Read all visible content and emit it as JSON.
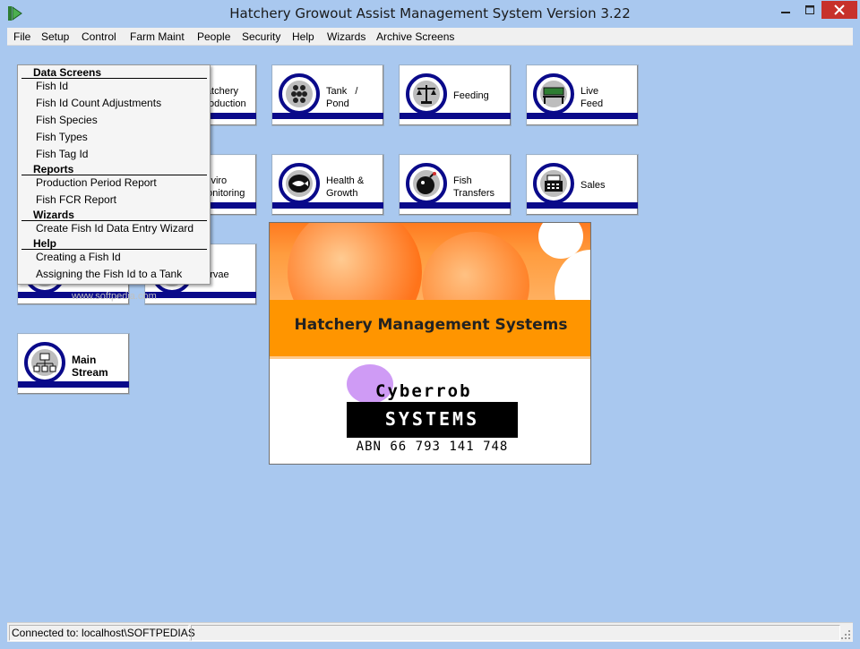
{
  "window": {
    "title": "Hatchery Growout Assist Management System Version 3.22",
    "icon": "green-arrow-icon"
  },
  "menubar": [
    "File",
    "Setup",
    "Control",
    "Farm Maint",
    "People",
    "Security",
    "Help",
    "Wizards",
    "Archive Screens"
  ],
  "tiles": {
    "hatchery_production": "Hatchery\nProduction",
    "tank_pond": "Tank   /\nPond",
    "feeding": "Feeding",
    "live_feed": "Live\nFeed",
    "enviro_monitoring": "Enviro\nMonitoring",
    "health_growth": "Health &\nGrowth",
    "fish_transfers": "Fish\nTransfers",
    "sales": "Sales",
    "larvae": "Larvae",
    "main_stream": "Main\nStream"
  },
  "dropdown": {
    "data_screens_header": "Data Screens",
    "data_screens": [
      "Fish Id",
      "Fish Id Count Adjustments",
      "Fish Species",
      "Fish Types",
      "Fish Tag Id"
    ],
    "reports_header": "Reports",
    "reports": [
      "Production Period Report",
      "Fish FCR Report"
    ],
    "wizards_header": "Wizards",
    "wizards": [
      "Create Fish Id Data Entry Wizard"
    ],
    "help_header": "Help",
    "help": [
      "Creating a Fish Id",
      "Assigning the Fish Id to a Tank"
    ]
  },
  "splash": {
    "title": "Hatchery Management Systems",
    "logo_cyber": "Cyberrob",
    "logo_systems": "SYSTEMS",
    "abn": "ABN 66 793 141 748"
  },
  "watermark": "www.softpedia.com",
  "statusbar": {
    "connection": "Connected to: localhost\\SOFTPEDIAS"
  },
  "colors": {
    "background": "#a9c8ef",
    "tile_accent": "#0a0a8a",
    "close_button": "#c7312b",
    "splash_orange": "#ff9500"
  }
}
